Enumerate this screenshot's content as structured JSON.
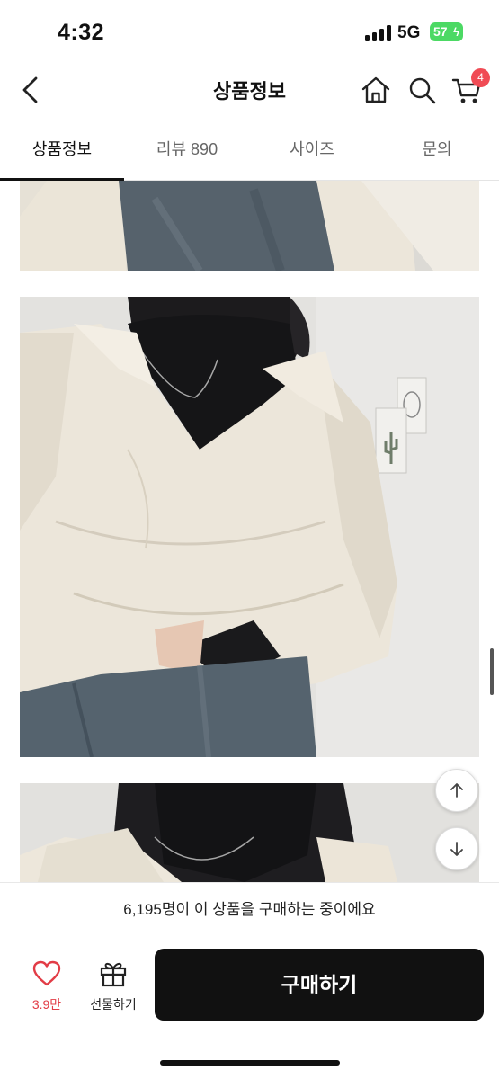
{
  "status_bar": {
    "time": "4:32",
    "network": "5G",
    "battery": "57"
  },
  "header": {
    "title": "상품정보",
    "cart_count": "4"
  },
  "tabs": [
    {
      "label": "상품정보",
      "active": true
    },
    {
      "label": "리뷰 890",
      "active": false
    },
    {
      "label": "사이즈",
      "active": false
    },
    {
      "label": "문의",
      "active": false
    }
  ],
  "buyers_text": "6,195명이 이 상품을 구매하는 중이에요",
  "bottom_bar": {
    "like_count": "3.9만",
    "gift_label": "선물하기",
    "buy_label": "구매하기"
  },
  "colors": {
    "accent_red": "#e23c46",
    "badge": "#f04b55",
    "buy_button": "#111111",
    "battery": "#4cd964"
  },
  "icons": [
    "back-arrow-icon",
    "home-icon",
    "search-icon",
    "cart-icon",
    "scroll-up-icon",
    "scroll-down-icon",
    "heart-icon",
    "gift-icon"
  ]
}
